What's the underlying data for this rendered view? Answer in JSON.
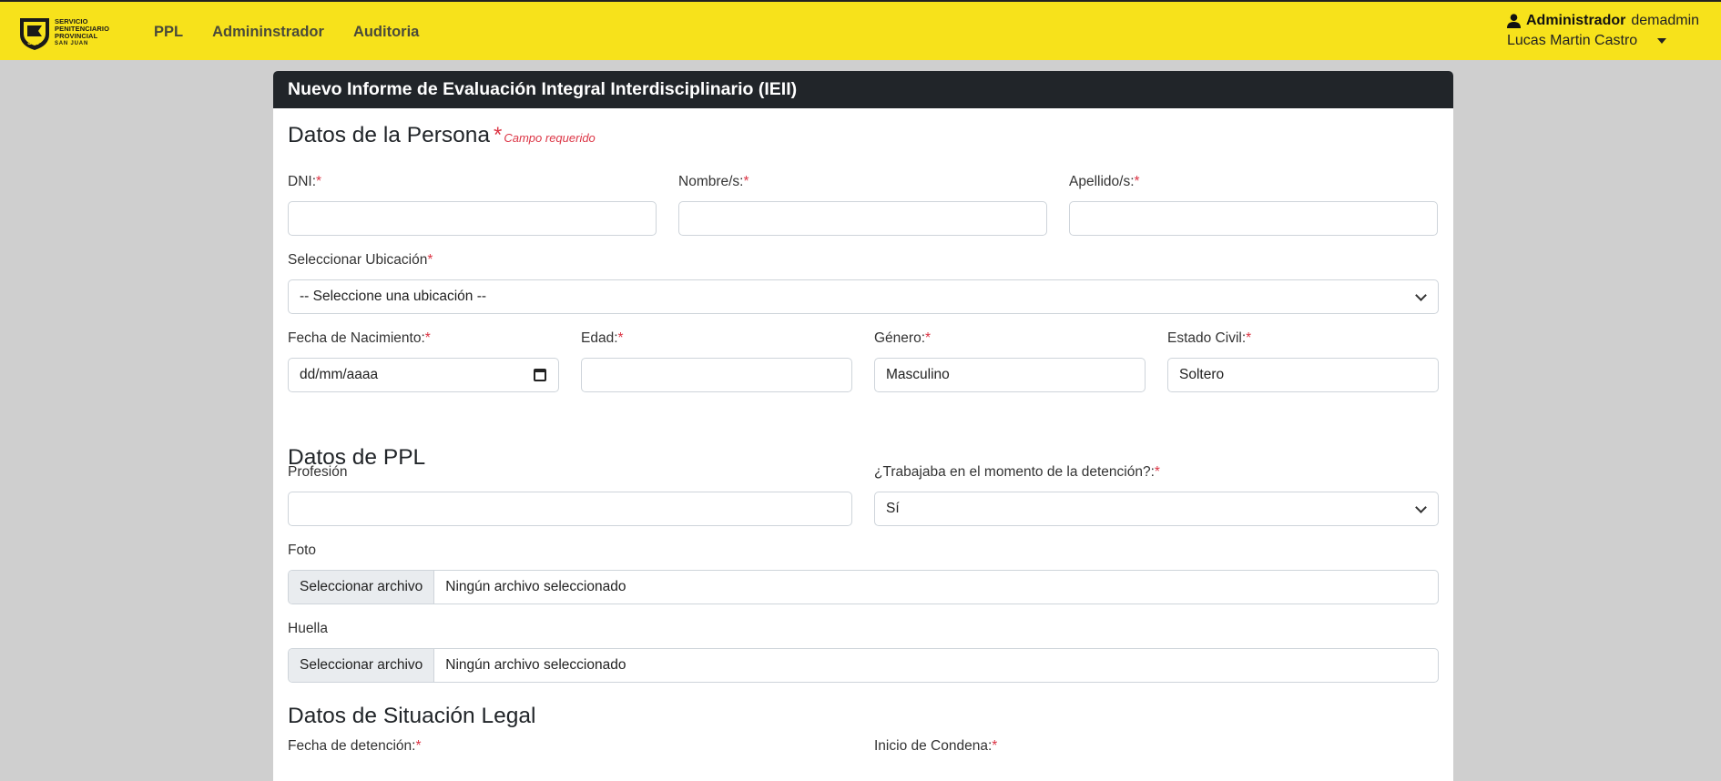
{
  "navbar": {
    "logo": {
      "lines": [
        "SERVICIO",
        "PENITENCIARIO",
        "PROVINCIAL"
      ],
      "sub": "SAN JUAN",
      "badge": "SPP"
    },
    "links": [
      "PPL",
      "Admininstrador",
      "Auditoria"
    ],
    "user": {
      "role": "Administrador",
      "username": "demadmin",
      "fullname": "Lucas Martin Castro"
    },
    "colors": {
      "background": "#f7e21b",
      "text": "#4a4a3a"
    }
  },
  "card": {
    "title": "Nuevo Informe de Evaluación Integral Interdisciplinario (IEII)"
  },
  "persona": {
    "title": "Datos de la Persona",
    "required_star": "*",
    "required_note": "Campo requerido",
    "dni": {
      "label": "DNI:",
      "value": ""
    },
    "nombre": {
      "label": "Nombre/s:",
      "value": ""
    },
    "apellido": {
      "label": "Apellido/s:",
      "value": ""
    },
    "ubicacion": {
      "label": "Seleccionar Ubicación",
      "value": "-- Seleccione una ubicación --"
    },
    "nacimiento": {
      "label": "Fecha de Nacimiento:",
      "value": "dd/mm/aaaa"
    },
    "edad": {
      "label": "Edad:",
      "value": ""
    },
    "genero": {
      "label": "Género:",
      "value": "Masculino"
    },
    "estado_civil": {
      "label": "Estado Civil:",
      "value": "Soltero"
    }
  },
  "ppl": {
    "title": "Datos de PPL",
    "profesion": {
      "label": "Profesión",
      "value": ""
    },
    "trabajaba": {
      "label": "¿Trabajaba en el momento de la detención?:",
      "value": "Sí"
    },
    "foto": {
      "label": "Foto",
      "button": "Seleccionar archivo",
      "status": "Ningún archivo seleccionado"
    },
    "huella": {
      "label": "Huella",
      "button": "Seleccionar archivo",
      "status": "Ningún archivo seleccionado"
    }
  },
  "legal": {
    "title": "Datos de Situación Legal",
    "detencion": {
      "label": "Fecha de detención:"
    },
    "condena": {
      "label": "Inicio de Condena:"
    }
  },
  "colors": {
    "required": "#dc3545",
    "header": "#212529",
    "page": "#cfcfcf"
  }
}
